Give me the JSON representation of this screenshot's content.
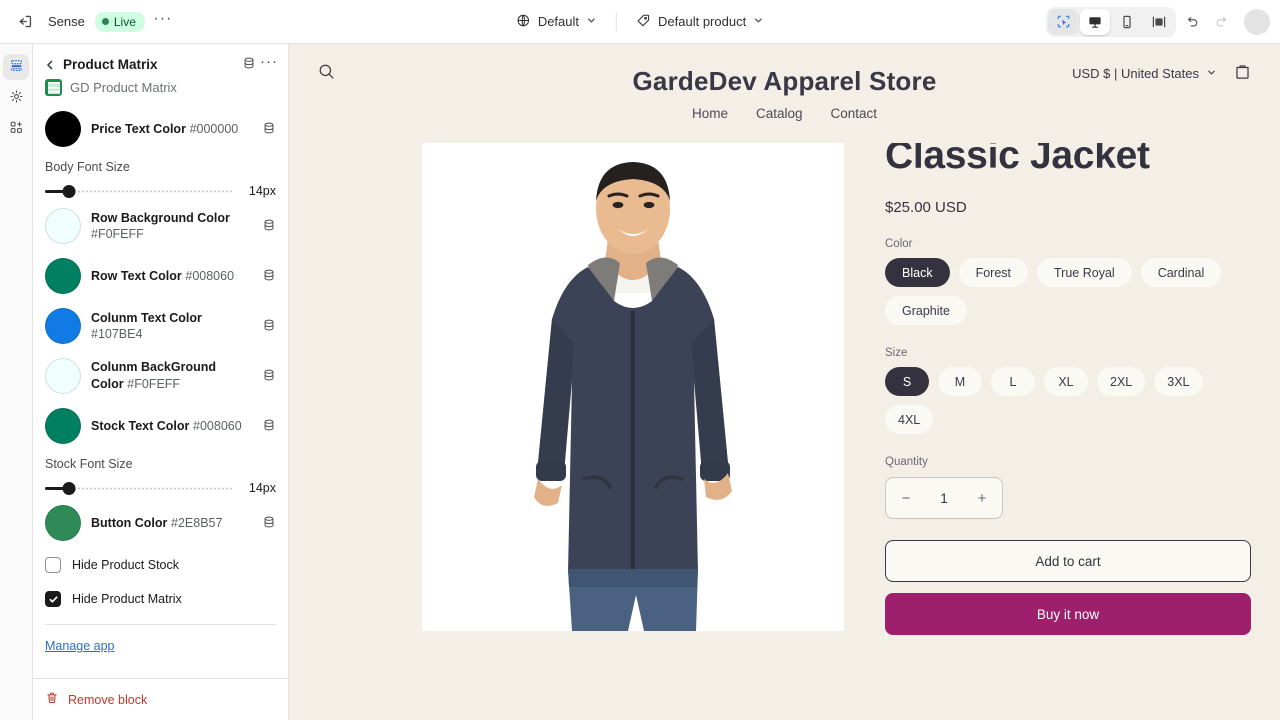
{
  "topbar": {
    "exit_icon": "exit-icon",
    "shop_name": "Sense",
    "status_badge": "Live",
    "more_icon": "ellipsis-icon",
    "theme_selector": {
      "icon": "globe-icon",
      "label": "Default",
      "chevron": "chevron-down-icon"
    },
    "template_selector": {
      "icon": "tag-icon",
      "label": "Default product",
      "chevron": "chevron-down-icon"
    },
    "devices": [
      {
        "name": "select-tool",
        "icon": "cursor-select-icon",
        "active": true
      },
      {
        "name": "desktop",
        "icon": "desktop-icon",
        "active": true
      },
      {
        "name": "mobile",
        "icon": "mobile-icon",
        "active": false
      },
      {
        "name": "full-width",
        "icon": "fullwidth-icon",
        "active": false
      }
    ],
    "undo_icon": "undo-icon",
    "redo_icon": "redo-icon"
  },
  "rail": [
    {
      "name": "sections",
      "icon": "sections-icon",
      "active": true
    },
    {
      "name": "theme-settings",
      "icon": "gear-icon",
      "active": false
    },
    {
      "name": "apps",
      "icon": "apps-add-icon",
      "active": false
    }
  ],
  "panel": {
    "back_icon": "chevron-left-icon",
    "title": "Product Matrix",
    "database_icon": "database-icon",
    "more_icon": "ellipsis-icon",
    "app_name": "GD Product Matrix",
    "app_icon": "spreadsheet-icon",
    "settings": [
      {
        "type": "color",
        "label": "Price Text Color",
        "value": "#000000",
        "swatch": "#000000",
        "icon": "database-icon"
      },
      {
        "type": "slider",
        "label": "Body Font Size",
        "value": "14px",
        "percent": 13
      },
      {
        "type": "color",
        "label": "Row Background Color",
        "value": "#F0FEFF",
        "swatch": "#F0FEFF",
        "icon": "database-icon"
      },
      {
        "type": "color",
        "label": "Row Text Color",
        "value": "#008060",
        "swatch": "#008060",
        "icon": "database-icon"
      },
      {
        "type": "color",
        "label": "Colunm Text Color",
        "value": "#107BE4",
        "swatch": "#107BE4",
        "icon": "database-icon"
      },
      {
        "type": "color",
        "label": "Colunm BackGround Color",
        "value": "#F0FEFF",
        "swatch": "#F0FEFF",
        "icon": "database-icon"
      },
      {
        "type": "color",
        "label": "Stock Text Color",
        "value": "#008060",
        "swatch": "#008060",
        "icon": "database-icon"
      },
      {
        "type": "slider",
        "label": "Stock Font Size",
        "value": "14px",
        "percent": 13
      },
      {
        "type": "color",
        "label": "Button Color",
        "value": "#2E8B57",
        "swatch": "#2E8B57",
        "icon": "database-icon"
      }
    ],
    "checkboxes": [
      {
        "label": "Hide Product Stock",
        "checked": false
      },
      {
        "label": "Hide Product Matrix",
        "checked": true
      }
    ],
    "manage_app": "Manage app",
    "remove_block": "Remove block",
    "trash_icon": "trash-icon"
  },
  "store": {
    "search_icon": "search-icon",
    "title": "GardeDev Apparel Store",
    "currency": "USD $ | United States",
    "currency_chevron": "chevron-down-icon",
    "cart_icon": "cart-icon",
    "nav": [
      "Home",
      "Catalog",
      "Contact"
    ],
    "product": {
      "image_alt": "man wearing navy three season classic jacket",
      "title": "Men's Three Season Classic Jacket",
      "price": "$25.00 USD",
      "color_label": "Color",
      "colors": [
        "Black",
        "Forest",
        "True Royal",
        "Cardinal",
        "Graphite"
      ],
      "color_selected": "Black",
      "size_label": "Size",
      "sizes": [
        "S",
        "M",
        "L",
        "XL",
        "2XL",
        "3XL",
        "4XL"
      ],
      "size_selected": "S",
      "quantity_label": "Quantity",
      "quantity_value": "1",
      "quantity_minus": "−",
      "quantity_plus": "+",
      "add_to_cart": "Add to cart",
      "buy_now": "Buy it now"
    }
  },
  "colors": {
    "accent_blue": "#2c6ecb",
    "live_green": "#29845a",
    "buy_magenta": "#9e1f6b",
    "preview_bg": "#f3efe6",
    "remove_red": "#c0392b"
  }
}
